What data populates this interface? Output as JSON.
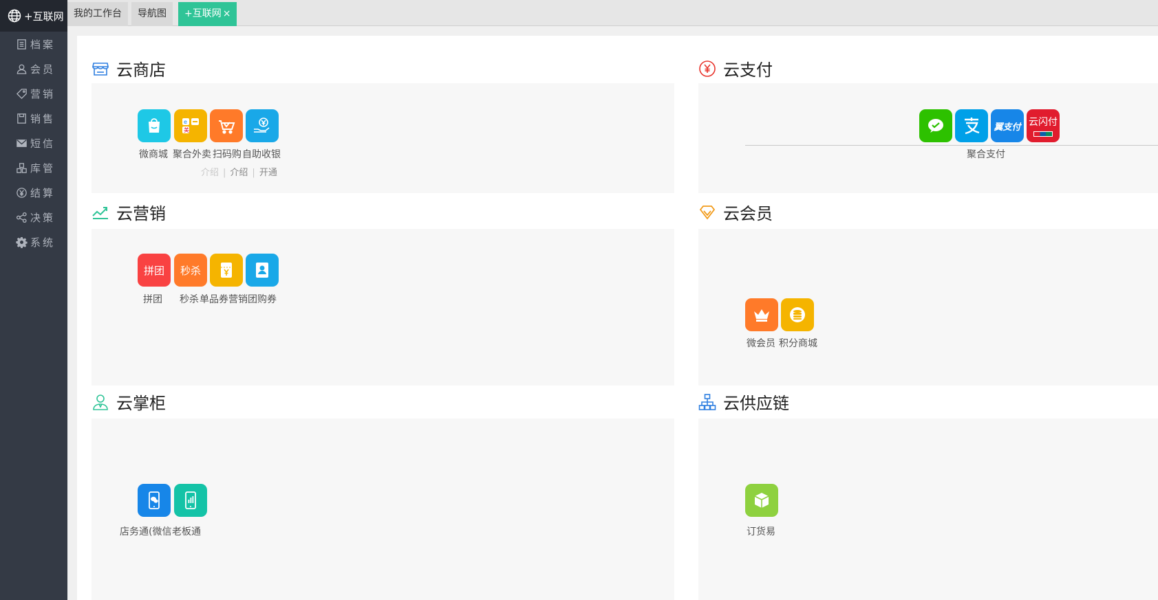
{
  "sidebar": {
    "brand": "+互联网",
    "items": [
      {
        "label": "档案",
        "icon": "document-icon"
      },
      {
        "label": "会员",
        "icon": "user-icon"
      },
      {
        "label": "营销",
        "icon": "tag-icon"
      },
      {
        "label": "销售",
        "icon": "sales-icon"
      },
      {
        "label": "短信",
        "icon": "mail-icon"
      },
      {
        "label": "库管",
        "icon": "warehouse-icon"
      },
      {
        "label": "结算",
        "icon": "yen-circle-icon"
      },
      {
        "label": "决策",
        "icon": "share-nodes-icon"
      },
      {
        "label": "系统",
        "icon": "gear-icon"
      }
    ]
  },
  "tabs": [
    {
      "label": "我的工作台"
    },
    {
      "label": "导航图"
    },
    {
      "label": "+互联网",
      "active": true,
      "close": "×"
    }
  ],
  "sections": {
    "shop": {
      "title": "云商店",
      "apps": [
        {
          "label": "微商城",
          "icon": "shopping-bag-icon",
          "color": "#1ec8e6"
        },
        {
          "label": "聚合外卖",
          "icon": "delivery-icon",
          "color": "#f5b400"
        },
        {
          "label": "扫码购",
          "icon": "cart-icon",
          "color": "#ff7a29"
        },
        {
          "label": "自助收银",
          "icon": "cashier-icon",
          "color": "#19a8e8"
        }
      ],
      "links": [
        "介绍",
        "介绍",
        "开通"
      ]
    },
    "pay": {
      "title": "云支付",
      "apps": [
        {
          "icon": "wechat-icon",
          "color": "#2dc100"
        },
        {
          "icon": "alipay-icon",
          "color": "#00a0e8"
        },
        {
          "label": "翼支付",
          "icon": "bestpay-icon",
          "color": "#1786e8"
        },
        {
          "label": "云闪付",
          "icon": "unionpay-icon",
          "color": "#e11c2e"
        }
      ],
      "caption": "聚合支付"
    },
    "marketing": {
      "title": "云营销",
      "apps": [
        {
          "label": "拼团",
          "color": "#f94242"
        },
        {
          "label": "秒杀",
          "color": "#ff7a29"
        },
        {
          "label": "单品券",
          "icon": "coupon-icon",
          "color": "#f5b400"
        },
        {
          "label": "营销团购券",
          "icon": "group-coupon-icon",
          "color": "#19a8e8"
        }
      ]
    },
    "member": {
      "title": "云会员",
      "apps": [
        {
          "label": "微会员",
          "icon": "crown-icon",
          "color": "#ff7a29"
        },
        {
          "label": "积分商城",
          "icon": "coins-icon",
          "color": "#f5b400"
        }
      ]
    },
    "manager": {
      "title": "云掌柜",
      "apps": [
        {
          "label": "店务通(微信",
          "icon": "wechat-phone-icon",
          "color": "#1786e8"
        },
        {
          "label": "老板通",
          "icon": "chart-phone-icon",
          "color": "#14c3a7"
        }
      ]
    },
    "supply": {
      "title": "云供应链",
      "apps": [
        {
          "label": "订货易",
          "icon": "box-icon",
          "color": "#8ed13f"
        }
      ]
    }
  }
}
